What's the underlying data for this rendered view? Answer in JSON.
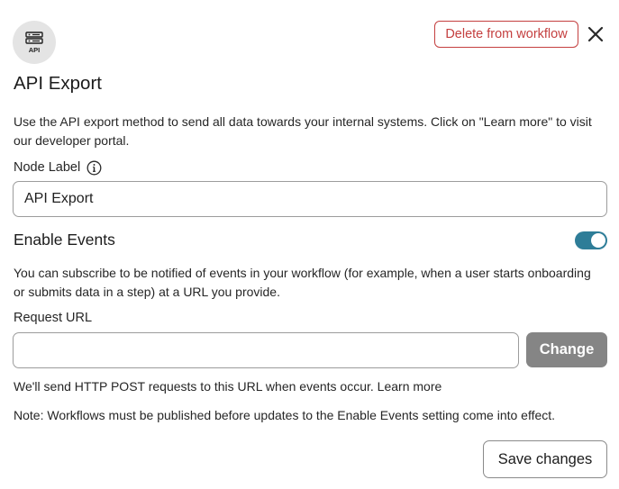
{
  "header": {
    "icon_name": "api-server-icon",
    "icon_text": "API",
    "delete_label": "Delete from workflow",
    "close_icon": "close-icon"
  },
  "title": "API Export",
  "description": "Use the API export method to send all data towards your internal systems. Click on \"Learn more\" to visit our developer portal.",
  "node_label": {
    "label": "Node Label",
    "info_icon": "info-icon",
    "value": "API Export"
  },
  "events": {
    "title": "Enable Events",
    "enabled": true,
    "description": "You can subscribe to be notified of events in your workflow (for example, when a user starts onboarding or submits data in a step) at a URL you provide."
  },
  "request_url": {
    "label": "Request URL",
    "value": "",
    "change_label": "Change"
  },
  "post_note": {
    "text": "We'll send HTTP POST requests to this URL when events occur.",
    "learn_more": "Learn more"
  },
  "publish_note": "Note: Workflows must be published before updates to the Enable Events setting come into effect.",
  "save_label": "Save changes",
  "colors": {
    "danger": "#c43f3f",
    "toggle_on": "#2e7d98",
    "disabled_button": "#858585"
  }
}
